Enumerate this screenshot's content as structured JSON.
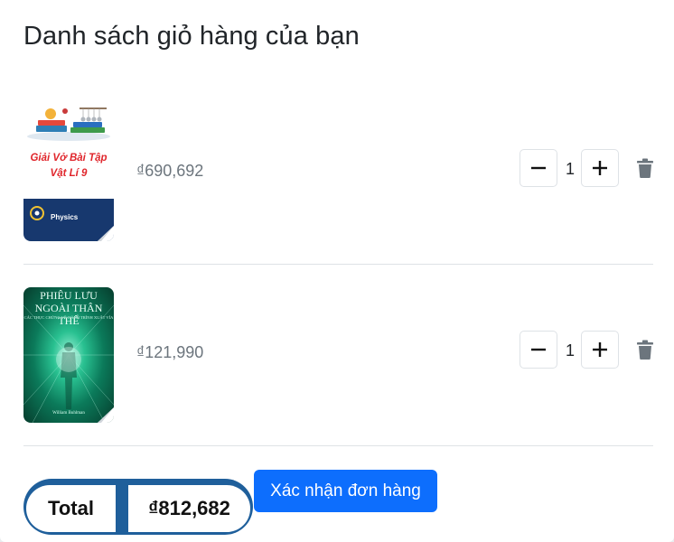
{
  "cart": {
    "title": "Danh sách giỏ hàng của bạn",
    "items": [
      {
        "cover_text": "Giải Vở Bài Tập\nVật Lí 9",
        "cover_subject": "Physics",
        "price": "₫690,692",
        "quantity": "1",
        "cover_colors": {
          "text": "#e0252b",
          "band": "#17386e"
        }
      },
      {
        "cover_title": "PHIÊU LƯU\nNGOÀI THÂN THỂ",
        "cover_subtitle": "CÁC THỰC CHỨNG VỀ HẢNH TRÌNH XUẤT VÍA",
        "cover_author": "William Buhlman",
        "price": "₫121,990",
        "quantity": "1",
        "cover_colors": {
          "glow": "#29c191",
          "dark": "#063d2d"
        }
      }
    ],
    "icons": {
      "minus": "minus-icon",
      "plus": "plus-icon",
      "trash": "trash-icon"
    }
  },
  "summary": {
    "total_label": "Total",
    "total_value": "₫812,682",
    "confirm_label": "Xác nhận đơn hàng"
  },
  "colors": {
    "primary": "#0d6efd",
    "total_pill": "#1f5f9b",
    "price_text": "#6c757d",
    "trash": "#6c757d"
  }
}
